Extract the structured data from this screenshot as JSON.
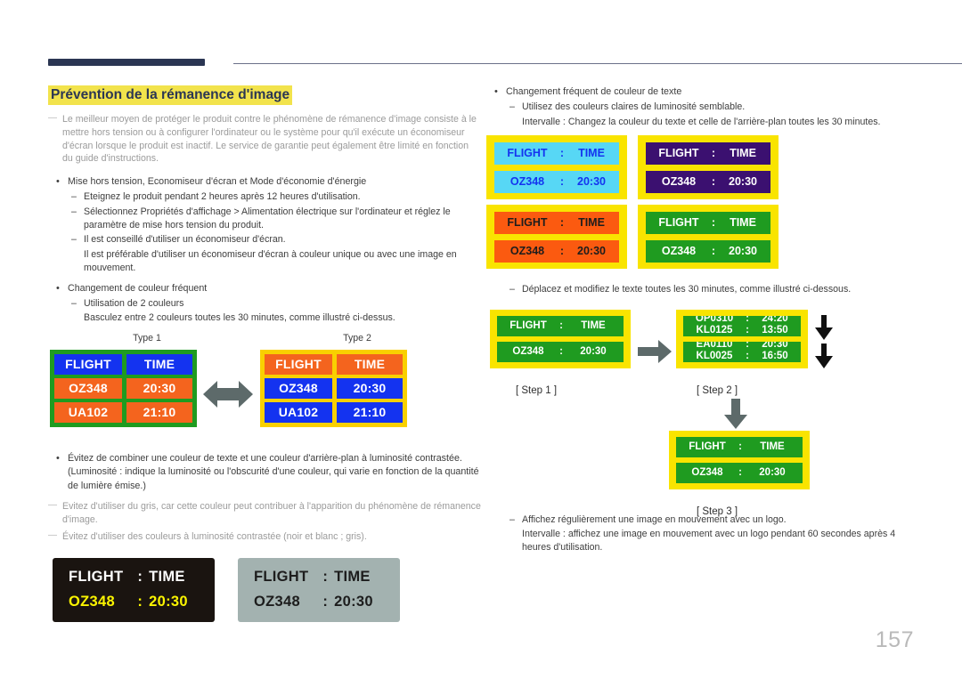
{
  "page": {
    "number": "157"
  },
  "colors": {
    "header_bar": "#2b3653",
    "title_highlight": "#f2e34c",
    "title_text": "#2b3653",
    "note_text": "#9b9b9b",
    "body_text": "#3d3d3d",
    "green_border": "#1f9b20",
    "yellow_border": "#f9e400",
    "blue_cell": "#1433f0",
    "orange_cell": "#f4641e",
    "page_number": "#b9b9b9"
  },
  "left": {
    "title": "Prévention de la rémanence d'image",
    "intro_note": "Le meilleur moyen de protéger le produit contre le phénomène de rémanence d'image consiste à le mettre hors tension ou à configurer l'ordinateur ou le système pour qu'il exécute un économiseur d'écran lorsque le produit est inactif. Le service de garantie peut également être limité en fonction du guide d'instructions.",
    "bullet1": "Mise hors tension, Economiseur d'écran et Mode d'économie d'énergie",
    "bullet1_items": [
      "Eteignez le produit pendant 2 heures après 12 heures d'utilisation.",
      "Sélectionnez Propriétés d'affichage > Alimentation électrique sur l'ordinateur et réglez le paramètre de mise hors tension du produit.",
      "Il est conseillé d'utiliser un économiseur d'écran."
    ],
    "bullet1_item3_cont": "Il est préférable d'utiliser un économiseur d'écran à couleur unique ou avec une image en mouvement.",
    "bullet2": "Changement de couleur fréquent",
    "bullet2_item": "Utilisation de 2 couleurs",
    "bullet2_item_cont": "Basculez entre 2 couleurs toutes les 30 minutes, comme illustré ci-dessus.",
    "bullet3": "Évitez de combiner une couleur de texte et une couleur d'arrière-plan à luminosité contrastée. (Luminosité : indique la luminosité ou l'obscurité d'une couleur, qui varie en fonction de la quantité de lumière émise.)",
    "note2": "Evitez d'utiliser du gris, car cette couleur peut contribuer à l'apparition du phénomène de rémanence d'image.",
    "note3": "Évitez d'utiliser des couleurs à luminosité contrastée (noir et blanc ; gris).",
    "types": [
      {
        "label": "Type 1",
        "border": "#1f9b20",
        "rows": [
          {
            "c1": "FLIGHT",
            "c2": "TIME",
            "bg": "#1433f0",
            "fg": "#ffffff"
          },
          {
            "c1": "OZ348",
            "c2": "20:30",
            "bg": "#f4641e",
            "fg": "#ffffff"
          },
          {
            "c1": "UA102",
            "c2": "21:10",
            "bg": "#f4641e",
            "fg": "#ffffff"
          }
        ]
      },
      {
        "label": "Type 2",
        "border": "#f9d000",
        "rows": [
          {
            "c1": "FLIGHT",
            "c2": "TIME",
            "bg": "#f4641e",
            "fg": "#ffffff"
          },
          {
            "c1": "OZ348",
            "c2": "20:30",
            "bg": "#1433f0",
            "fg": "#ffffff"
          },
          {
            "c1": "UA102",
            "c2": "21:10",
            "bg": "#1433f0",
            "fg": "#ffffff"
          }
        ]
      }
    ],
    "swap_arrow_icon": "double-headed-horizontal-arrow",
    "contrast_panels": [
      {
        "bg": "#1a1410",
        "row1": {
          "c1": "FLIGHT",
          "sep": ":",
          "c2": "TIME",
          "fg": "#ffffff"
        },
        "row2": {
          "c1": "OZ348",
          "sep": ":",
          "c2": "20:30",
          "fg": "#fbf500"
        }
      },
      {
        "bg": "#a3b2b0",
        "row1": {
          "c1": "FLIGHT",
          "sep": ":",
          "c2": "TIME",
          "fg": "#1d1d1d"
        },
        "row2": {
          "c1": "OZ348",
          "sep": ":",
          "c2": "20:30",
          "fg": "#1d1d1d"
        }
      }
    ]
  },
  "right": {
    "bullet1": "Changement fréquent de couleur de texte",
    "bullet1_item": "Utilisez des couleurs claires de luminosité semblable.",
    "bullet1_item_cont": "Intervalle : Changez la couleur du texte et celle de l'arrière-plan toutes les 30 minutes.",
    "samples": [
      {
        "bg": "#57d7f5",
        "fg": "#1433f0",
        "row1": {
          "c1": "FLIGHT",
          "sep": ":",
          "c2": "TIME"
        },
        "row2": {
          "c1": "OZ348",
          "sep": ":",
          "c2": "20:30"
        }
      },
      {
        "bg": "#3b1070",
        "fg": "#ffffff",
        "row1": {
          "c1": "FLIGHT",
          "sep": ":",
          "c2": "TIME"
        },
        "row2": {
          "c1": "OZ348",
          "sep": ":",
          "c2": "20:30"
        }
      },
      {
        "bg": "#fb5a10",
        "fg": "#1d1d1d",
        "row1": {
          "c1": "FLIGHT",
          "sep": ":",
          "c2": "TIME"
        },
        "row2": {
          "c1": "OZ348",
          "sep": ":",
          "c2": "20:30"
        }
      },
      {
        "bg": "#1f9b20",
        "fg": "#ffffff",
        "row1": {
          "c1": "FLIGHT",
          "sep": ":",
          "c2": "TIME"
        },
        "row2": {
          "c1": "OZ348",
          "sep": ":",
          "c2": "20:30"
        }
      }
    ],
    "move_item": "Déplacez et modifiez le texte toutes les 30 minutes, comme illustré ci-dessous.",
    "steps": {
      "step1": {
        "label": "[ Step 1 ]",
        "row1": {
          "c1": "FLIGHT",
          "sep": ":",
          "c2": "TIME"
        },
        "row2": {
          "c1": "OZ348",
          "sep": ":",
          "c2": "20:30"
        }
      },
      "step2": {
        "label": "[ Step 2 ]",
        "row1_top": {
          "c1": "OP0310",
          "sep": ":",
          "c2": "24:20"
        },
        "row1_bottom": {
          "c1": "KL0125",
          "sep": ":",
          "c2": "13:50"
        },
        "row2_top": {
          "c1": "EA0110",
          "sep": ":",
          "c2": "20:30"
        },
        "row2_bottom": {
          "c1": "KL0025",
          "sep": ":",
          "c2": "16:50"
        }
      },
      "step3": {
        "label": "[ Step 3 ]",
        "row1": {
          "c1": "FLIGHT",
          "sep": ":",
          "c2": "TIME"
        },
        "row2": {
          "c1": "OZ348",
          "sep": ":",
          "c2": "20:30"
        }
      },
      "right_arrow_icon": "right-arrow",
      "down_arrow_icon": "down-arrow",
      "scroll_arrow_icon": "scroll-down-arrow"
    },
    "logo_item": "Affichez régulièrement une image en mouvement avec un logo.",
    "logo_item_cont": "Intervalle : affichez une image en mouvement avec un logo pendant 60 secondes après 4 heures d'utilisation."
  }
}
